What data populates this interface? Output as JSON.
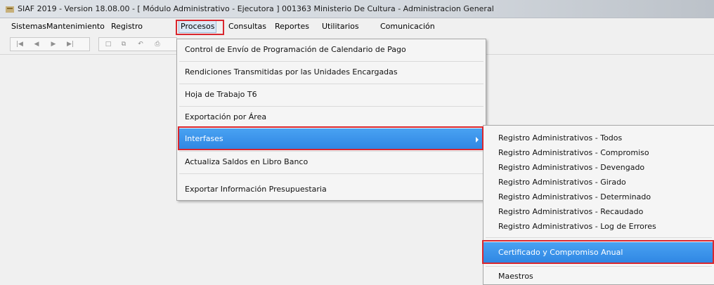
{
  "window": {
    "title": "SIAF 2019 - Version 18.08.00 - [ Módulo Administrativo - Ejecutora ] 001363 Ministerio De Cultura - Administracion General",
    "icon": "app-icon"
  },
  "menubar": {
    "items": [
      {
        "label": "Sistemas"
      },
      {
        "label": "Mantenimiento"
      },
      {
        "label": "Registro"
      },
      {
        "label": "Procesos"
      },
      {
        "label": "Consultas"
      },
      {
        "label": "Reportes"
      },
      {
        "label": "Utilitarios"
      },
      {
        "label": "Comunicación"
      }
    ],
    "active": "Procesos"
  },
  "toolbar": {
    "buttons": [
      "first-record-icon",
      "previous-record-icon",
      "next-record-icon",
      "last-record-icon",
      "new-icon",
      "copy-icon",
      "undo-icon",
      "print-icon"
    ]
  },
  "procesos_menu": {
    "items": [
      {
        "label": "Control de Envío de Programación de Calendario de Pago"
      },
      {
        "label": "Rendiciones Transmitidas por las Unidades Encargadas"
      },
      {
        "label": "Hoja de Trabajo T6"
      },
      {
        "label": "Exportación por Área"
      },
      {
        "label": "Interfases",
        "has_submenu": true,
        "selected": true
      },
      {
        "label": "Actualiza Saldos en Libro Banco"
      },
      {
        "label": "Exportar Información Presupuestaria"
      }
    ]
  },
  "interfases_submenu": {
    "items": [
      {
        "label": "Registro Administrativos - Todos"
      },
      {
        "label": "Registro Administrativos - Compromiso"
      },
      {
        "label": "Registro Administrativos - Devengado"
      },
      {
        "label": "Registro Administrativos - Girado"
      },
      {
        "label": "Registro Administrativos - Determinado"
      },
      {
        "label": "Registro Administrativos - Recaudado"
      },
      {
        "label": "Registro Administrativos - Log de Errores"
      },
      {
        "label": "Certificado y Compromiso Anual",
        "selected": true
      },
      {
        "label": "Maestros"
      }
    ]
  },
  "colors": {
    "highlight_outline": "#d9262e",
    "selection": "#3390e8"
  }
}
